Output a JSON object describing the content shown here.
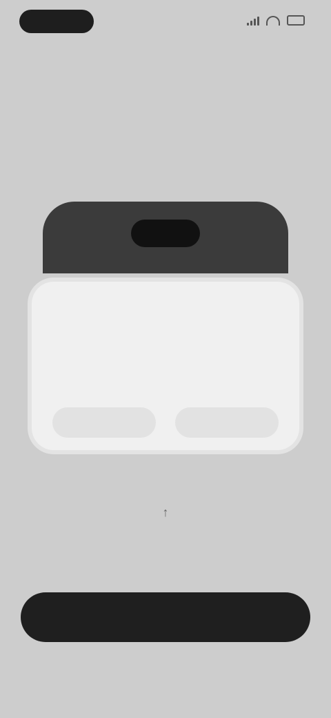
{
  "status_bar": {
    "time": "",
    "icons": [
      "signal-icon",
      "wifi-icon",
      "battery-icon"
    ]
  },
  "title": "",
  "dialog": {
    "title": "",
    "body": "",
    "secondary_label": "",
    "primary_label": ""
  },
  "hint": "",
  "cta_label": "",
  "footnote": "",
  "colors": {
    "background": "#cdcdcd",
    "dark": "#1f1f1f",
    "dialog": "#f0f0f0"
  }
}
